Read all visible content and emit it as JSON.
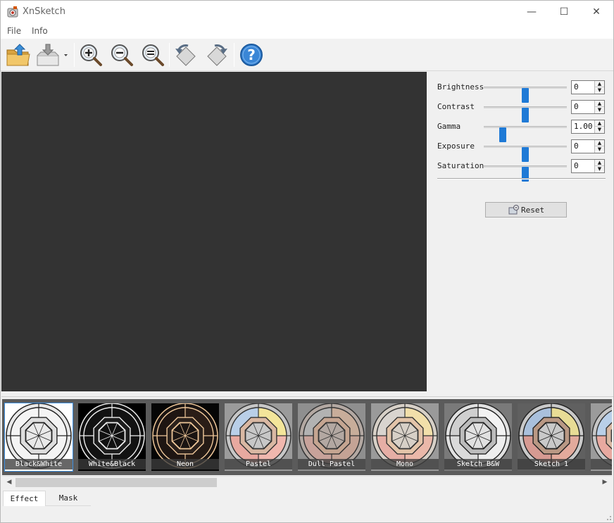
{
  "window": {
    "title": "XnSketch",
    "controls": {
      "minimize": "—",
      "maximize": "☐",
      "close": "✕"
    }
  },
  "menu": {
    "items": [
      "File",
      "Info"
    ]
  },
  "toolbar": {
    "buttons": [
      {
        "icon": "open-folder-icon"
      },
      {
        "icon": "save-icon"
      },
      {
        "icon": "zoom-in-icon"
      },
      {
        "icon": "zoom-out-icon"
      },
      {
        "icon": "zoom-fit-icon"
      },
      {
        "icon": "rotate-left-icon"
      },
      {
        "icon": "rotate-right-icon"
      },
      {
        "icon": "help-icon"
      }
    ]
  },
  "adjustments": {
    "rows": [
      {
        "label": "Brightness",
        "value": "0",
        "level": 0.5
      },
      {
        "label": "Contrast",
        "value": "0",
        "level": 0.5
      },
      {
        "label": "Gamma",
        "value": "1.00",
        "level": 0.2
      },
      {
        "label": "Exposure",
        "value": "0",
        "level": 0.5
      },
      {
        "label": "Saturation",
        "value": "0",
        "level": 0.5
      }
    ],
    "reset_label": "Reset"
  },
  "effects": {
    "items": [
      {
        "label": "Black&White",
        "style": "bw",
        "selected": true
      },
      {
        "label": "White&Black",
        "style": "wb",
        "selected": false
      },
      {
        "label": "Neon",
        "style": "neon",
        "selected": false
      },
      {
        "label": "Pastel",
        "style": "pastel",
        "selected": false
      },
      {
        "label": "Dull Pastel",
        "style": "dull",
        "selected": false
      },
      {
        "label": "Mono",
        "style": "mono",
        "selected": false
      },
      {
        "label": "Sketch B&W",
        "style": "sketchbw",
        "selected": false
      },
      {
        "label": "Sketch 1",
        "style": "sketch1",
        "selected": false
      },
      {
        "label": "S",
        "style": "pastel",
        "selected": false
      }
    ]
  },
  "tabs": {
    "effect": "Effect",
    "mask": "Mask"
  },
  "colors": {
    "canvas": "#333333",
    "accent": "#1f7ad6",
    "selection": "#3d8ee0"
  }
}
